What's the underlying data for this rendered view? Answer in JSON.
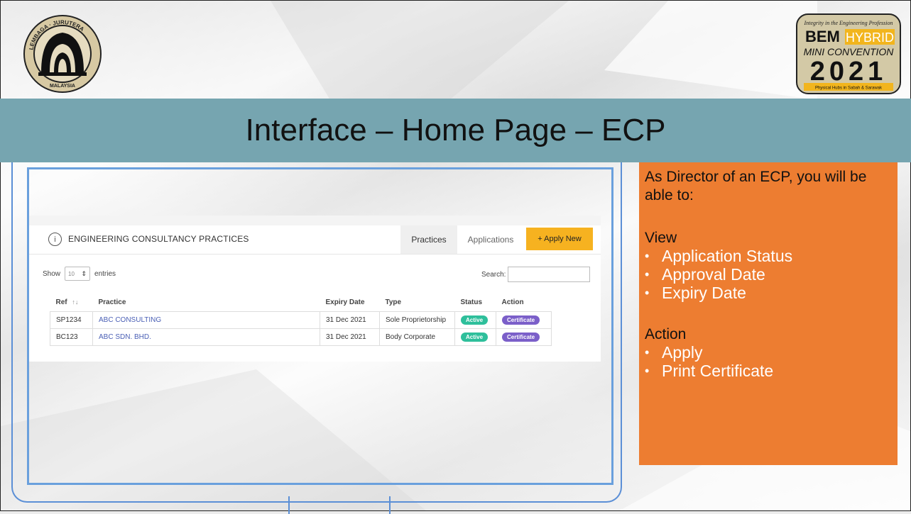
{
  "title": "Interface – Home Page – ECP",
  "logo_left": {
    "text": "LEMBAGA JURUTERA MALAYSIA"
  },
  "logo_right": {
    "tagline": "Integrity in the Engineering Profession",
    "line1_a": "BEM",
    "line1_b": "HYBRID",
    "line2": "MINI CONVENTION",
    "year": "2021",
    "footer": "Physical Hubs in Sabah & Sarawak"
  },
  "app": {
    "header_title": "ENGINEERING CONSULTANCY PRACTICES",
    "tabs": [
      "Practices",
      "Applications"
    ],
    "apply_label": "+ Apply New",
    "show_label": "Show",
    "entries_value": "10",
    "entries_label": "entries",
    "search_label": "Search:",
    "columns": [
      "Ref",
      "Practice",
      "Expiry Date",
      "Type",
      "Status",
      "Action"
    ],
    "rows": [
      {
        "ref": "SP1234",
        "practice": "ABC CONSULTING",
        "expiry": "31 Dec 2021",
        "type": "Sole Proprietorship",
        "status": "Active",
        "action": "Certificate"
      },
      {
        "ref": "BC123",
        "practice": "ABC SDN. BHD.",
        "expiry": "31 Dec 2021",
        "type": "Body Corporate",
        "status": "Active",
        "action": "Certificate"
      }
    ]
  },
  "panel": {
    "lead": "As Director of an ECP, you will be able to:",
    "view_heading": "View",
    "view_items": [
      "Application Status",
      "Approval Date",
      "Expiry Date"
    ],
    "action_heading": "Action",
    "action_items": [
      "Apply",
      "Print Certificate"
    ]
  }
}
